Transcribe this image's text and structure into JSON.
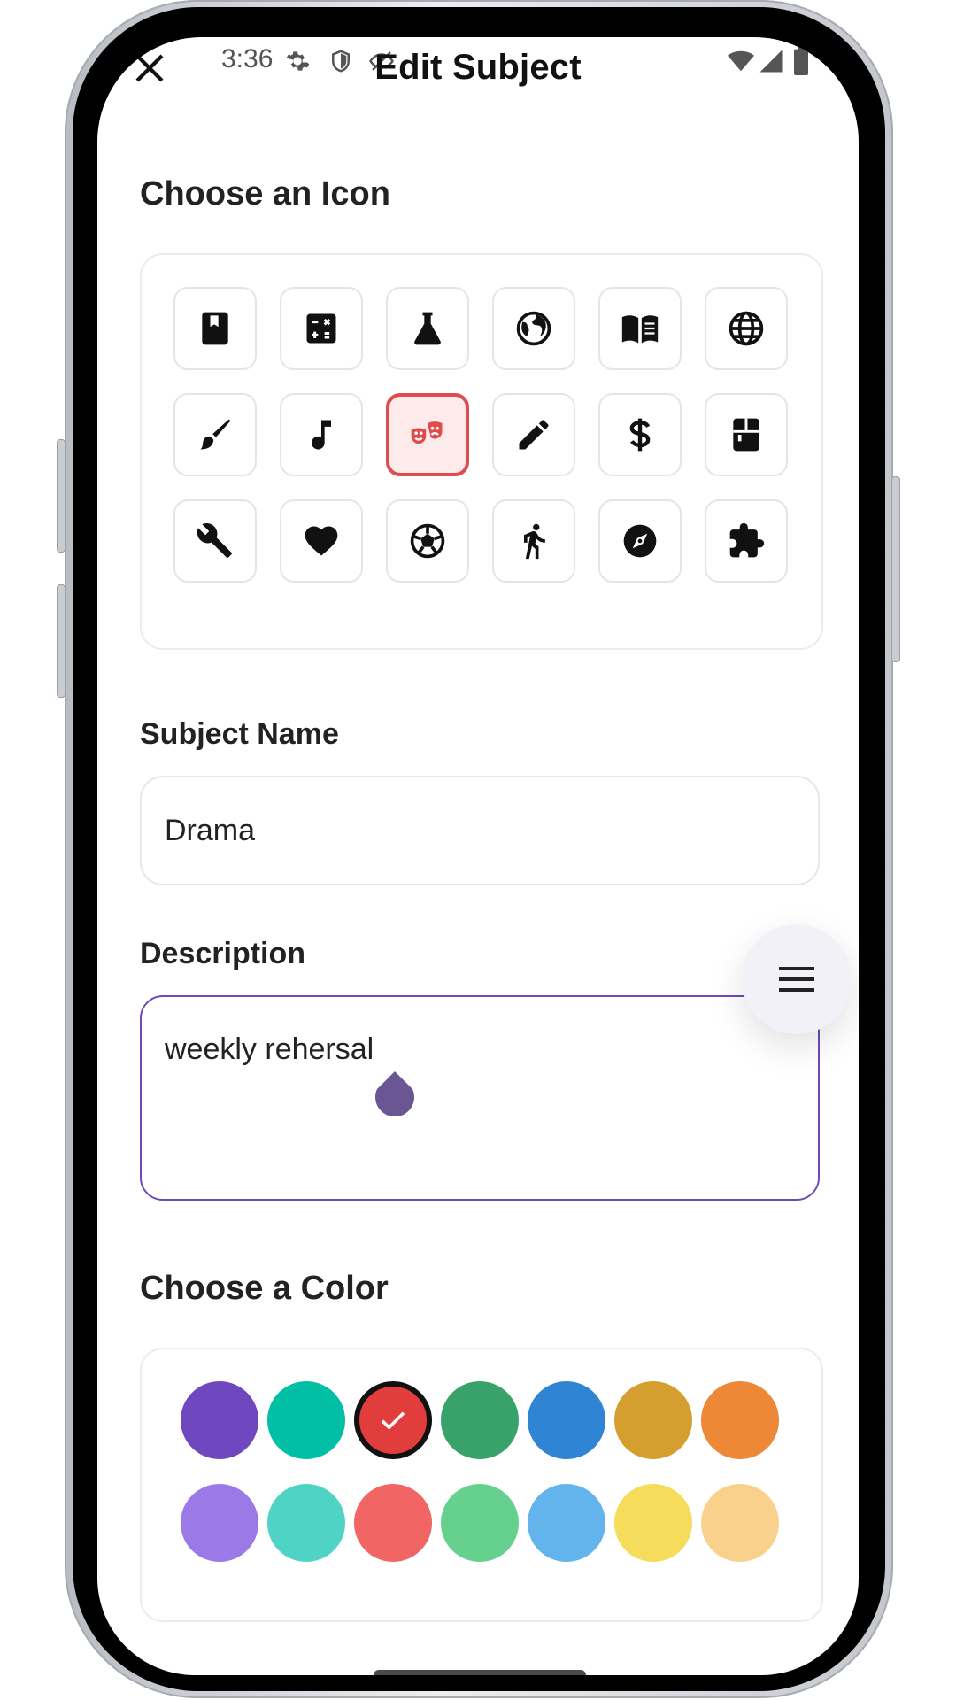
{
  "status_bar": {
    "time": "3:36"
  },
  "header": {
    "title": "Edit Subject"
  },
  "icon_section": {
    "title": "Choose an Icon",
    "selected_index": 8,
    "icons": [
      "book-icon",
      "calculator-icon",
      "flask-icon",
      "earth-icon",
      "open-book-icon",
      "globe-icon",
      "paintbrush-icon",
      "music-note-icon",
      "theater-masks-icon",
      "pencil-icon",
      "dollar-icon",
      "locker-icon",
      "wrench-icon",
      "heart-icon",
      "soccer-ball-icon",
      "walking-person-icon",
      "compass-icon",
      "puzzle-icon"
    ]
  },
  "name_field": {
    "label": "Subject Name",
    "value": "Drama"
  },
  "description_field": {
    "label": "Description",
    "value": "weekly rehersal"
  },
  "color_section": {
    "title": "Choose a Color",
    "selected_index": 2,
    "colors": [
      "#6f47bf",
      "#00bfa5",
      "#e23d3d",
      "#38a26a",
      "#2f84d4",
      "#d49f2e",
      "#ed8836",
      "#9b7ae7",
      "#4fd3c5",
      "#f26565",
      "#66d08f",
      "#63b4ec",
      "#f5dc5a",
      "#f9d18d"
    ]
  },
  "fab": {
    "icon": "menu-icon"
  }
}
